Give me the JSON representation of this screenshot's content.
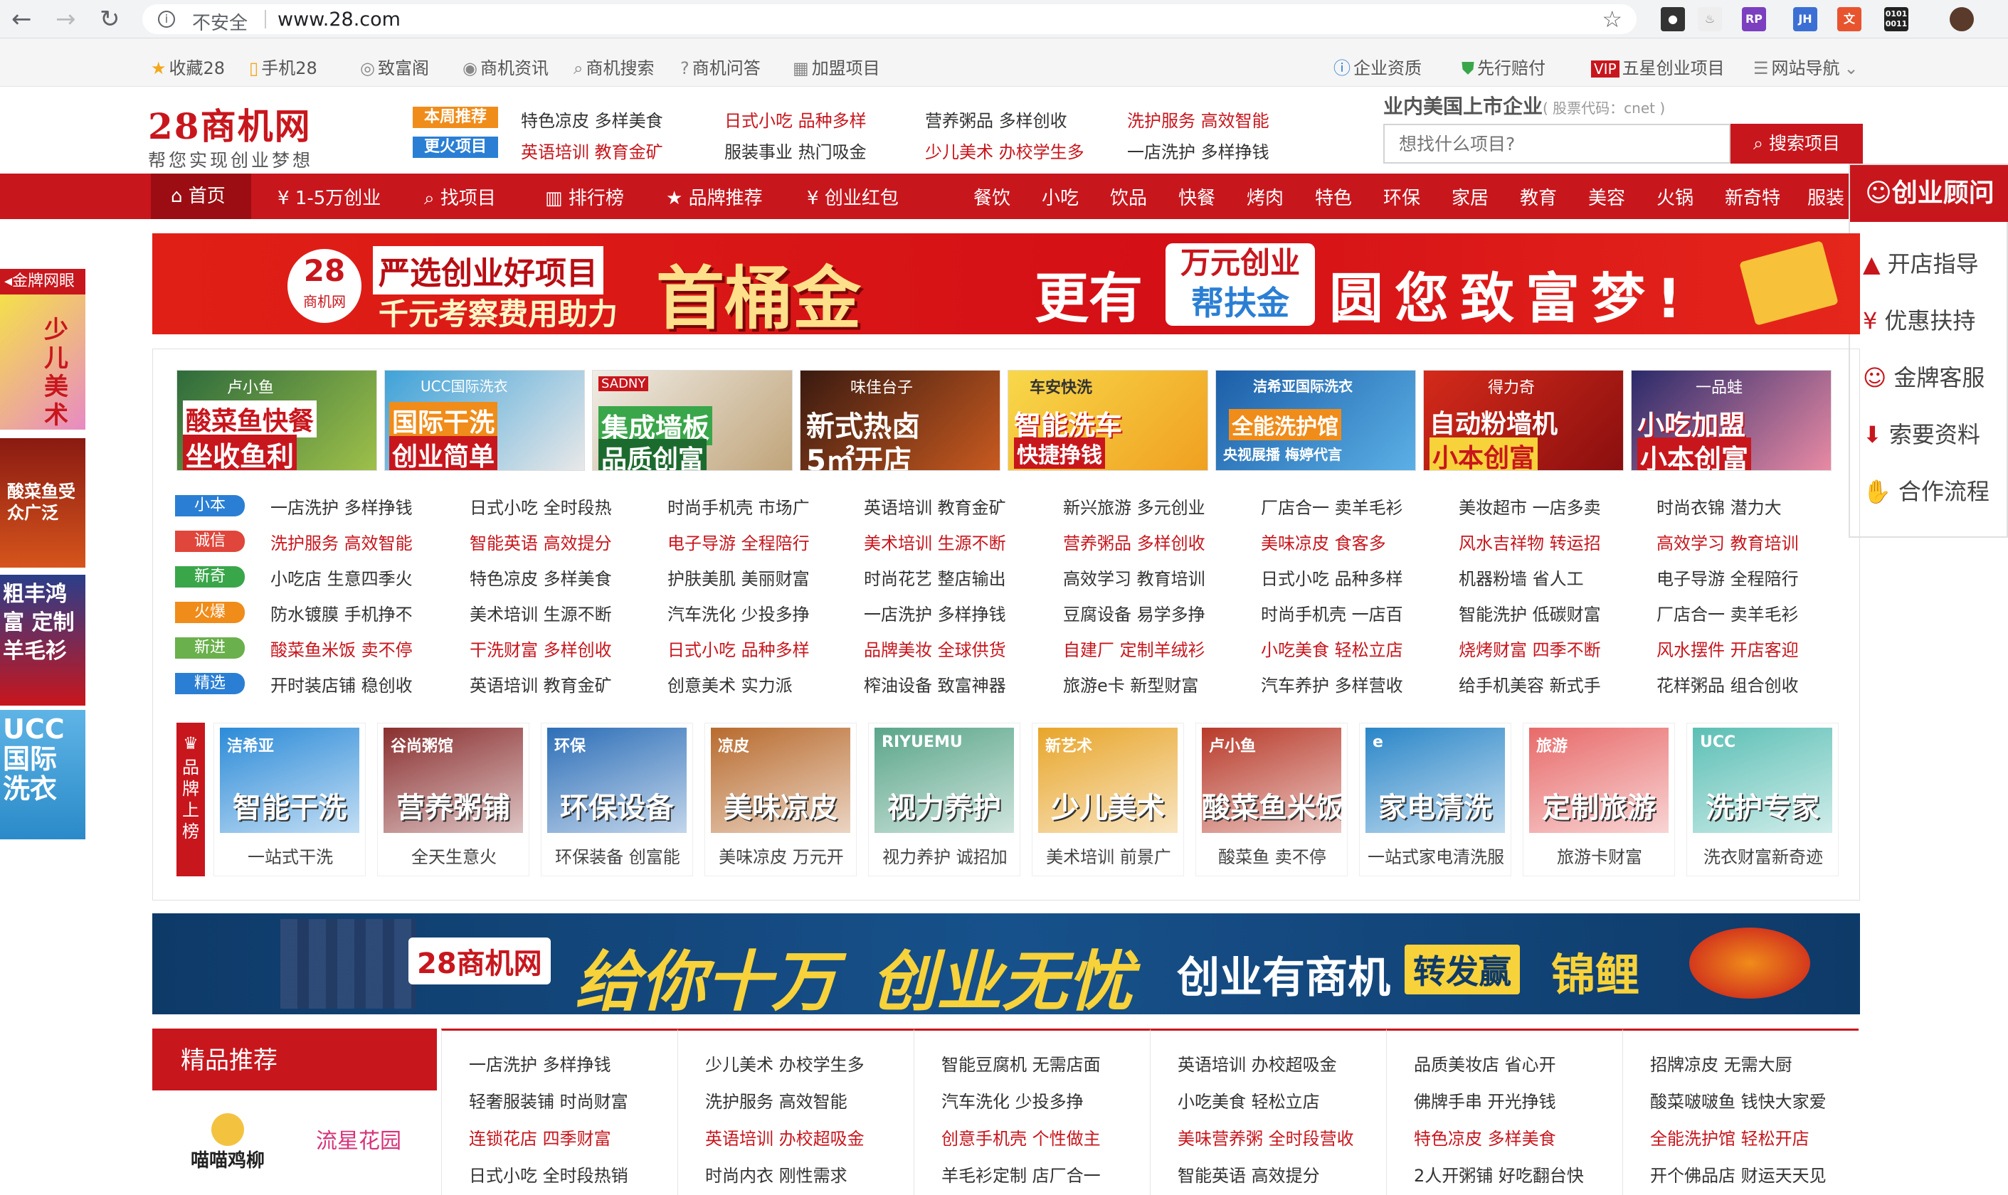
{
  "browser": {
    "security_label": "不安全",
    "url": "www.28.com"
  },
  "toplinks": {
    "left": [
      "收藏28",
      "手机28",
      "致富阁",
      "商机资讯",
      "商机搜索",
      "商机问答",
      "加盟项目"
    ],
    "right": [
      "企业资质",
      "先行赔付",
      "五星创业项目",
      "网站导航"
    ]
  },
  "header": {
    "logo_title": "28商机网",
    "logo_slogan": "帮您实现创业梦想",
    "badges": [
      "本周推荐",
      "更火项目"
    ],
    "links_row1": [
      "特色凉皮 多样美食",
      "日式小吃 品种多样",
      "营养粥品 多样创收",
      "洗护服务 高效智能"
    ],
    "links_row2": [
      "英语培训 教育金矿",
      "服装事业 热门吸金",
      "少儿美术 办校学生多",
      "一店洗护 多样挣钱"
    ],
    "listed_title": "业内美国上市企业",
    "listed_code": "( 股票代码：cnet )",
    "search_placeholder": "想找什么项目?",
    "search_button": "搜索项目"
  },
  "nav": {
    "main": [
      "首页",
      "1-5万创业",
      "找项目",
      "排行榜",
      "品牌推荐",
      "创业红包"
    ],
    "categories": [
      "餐饮",
      "小吃",
      "饮品",
      "快餐",
      "烤肉",
      "特色",
      "环保",
      "家居",
      "教育",
      "美容",
      "火锅",
      "新奇特",
      "服装"
    ]
  },
  "consult": {
    "title": "创业顾问",
    "items": [
      "开店指导",
      "优惠扶持",
      "金牌客服",
      "索要资料",
      "合作流程"
    ]
  },
  "banner1": {
    "logo": "28",
    "logo_sub": "商机网",
    "line1": "严选创业好项目",
    "line2": "千元考察费用助力",
    "big": "首桶金",
    "mid": "更有",
    "box1": "万元创业",
    "box2": "帮扶金",
    "tail": "圆您致富梦!"
  },
  "left_float": {
    "title": "金牌网眼",
    "ads": [
      "少儿美术",
      "酸菜鱼受众广泛",
      "粗丰鸿富 定制羊毛衫",
      "UCC国际洗衣"
    ]
  },
  "featured_tiles": [
    {
      "brand": "卢小鱼",
      "title": "酸菜鱼快餐",
      "sub": "坐收鱼利"
    },
    {
      "brand": "UCC国际洗衣",
      "title": "国际干洗",
      "sub": "创业简单"
    },
    {
      "brand": "SADNY",
      "title": "集成墙板",
      "sub": "品质创富"
    },
    {
      "brand": "味佳台子",
      "title": "新式热卤",
      "sub": "5㎡开店"
    },
    {
      "brand": "车安快洗",
      "title": "智能洗车",
      "sub": "快捷挣钱"
    },
    {
      "brand": "洁希亚国际洗衣",
      "title": "全能洗护馆",
      "sub": "央视展播 梅婷代言"
    },
    {
      "brand": "得力奇",
      "title": "自动粉墙机",
      "sub": "小本创富"
    },
    {
      "brand": "一品蛙",
      "title": "小吃加盟",
      "sub": "小本创富"
    }
  ],
  "tag_rows": [
    {
      "tag": "小本",
      "tag_color": "#2a7fd4",
      "items": [
        [
          "一店洗护 多样挣钱",
          0
        ],
        [
          "日式小吃 全时段热",
          0
        ],
        [
          "时尚手机壳 市场广",
          0
        ],
        [
          "英语培训 教育金矿",
          0
        ],
        [
          "新兴旅游 多元创业",
          0
        ],
        [
          "厂店合一 卖羊毛衫",
          0
        ],
        [
          "美妆超市 一店多卖",
          0
        ],
        [
          "时尚衣锦 潜力大",
          0
        ]
      ]
    },
    {
      "tag": "诚信",
      "tag_color": "#e0463b",
      "items": [
        [
          "洗护服务 高效智能",
          1
        ],
        [
          "智能英语 高效提分",
          1
        ],
        [
          "电子导游 全程陪行",
          1
        ],
        [
          "美术培训 生源不断",
          1
        ],
        [
          "营养粥品 多样创收",
          1
        ],
        [
          "美味凉皮 食客多",
          1
        ],
        [
          "风水吉祥物 转运招",
          1
        ],
        [
          "高效学习 教育培训",
          1
        ]
      ]
    },
    {
      "tag": "新奇",
      "tag_color": "#3aa64a",
      "items": [
        [
          "小吃店 生意四季火",
          0
        ],
        [
          "特色凉皮 多样美食",
          0
        ],
        [
          "护肤美肌 美丽财富",
          0
        ],
        [
          "时尚花艺 整店输出",
          0
        ],
        [
          "高效学习 教育培训",
          0
        ],
        [
          "日式小吃 品种多样",
          0
        ],
        [
          "机器粉墙 省人工",
          0
        ],
        [
          "电子导游 全程陪行",
          0
        ]
      ]
    },
    {
      "tag": "火爆",
      "tag_color": "#f08c1a",
      "items": [
        [
          "防水镀膜 手机挣不",
          0
        ],
        [
          "美术培训 生源不断",
          0
        ],
        [
          "汽车洗化 少投多挣",
          0
        ],
        [
          "一店洗护 多样挣钱",
          0
        ],
        [
          "豆腐设备 易学多挣",
          0
        ],
        [
          "时尚手机壳 一店百",
          0
        ],
        [
          "智能洗护 低碳财富",
          0
        ],
        [
          "厂店合一 卖羊毛衫",
          0
        ]
      ]
    },
    {
      "tag": "新进",
      "tag_color": "#6ab04c",
      "items": [
        [
          "酸菜鱼米饭 卖不停",
          1
        ],
        [
          "干洗财富 多样创收",
          1
        ],
        [
          "日式小吃 品种多样",
          1
        ],
        [
          "品牌美妆 全球供货",
          1
        ],
        [
          "自建厂 定制羊绒衫",
          1
        ],
        [
          "小吃美食 轻松立店",
          1
        ],
        [
          "烧烤财富 四季不断",
          1
        ],
        [
          "风水摆件 开店客迎",
          1
        ]
      ]
    },
    {
      "tag": "精选",
      "tag_color": "#2a7fd4",
      "items": [
        [
          "开时装店铺 稳创收",
          0
        ],
        [
          "英语培训 教育金矿",
          0
        ],
        [
          "创意美术 实力派",
          0
        ],
        [
          "榨油设备 致富神器",
          0
        ],
        [
          "旅游e卡 新型财富",
          0
        ],
        [
          "汽车养护 多样营收",
          0
        ],
        [
          "给手机美容 新式手",
          0
        ],
        [
          "花样粥品 组合创收",
          0
        ]
      ]
    }
  ],
  "brand_side": "品牌上榜",
  "brands": [
    {
      "title": "智能干洗",
      "logo": "洁希亚",
      "caption": "一站式干洗",
      "bg": "#2c8bd8"
    },
    {
      "title": "营养粥铺",
      "logo": "谷尚粥馆",
      "caption": "全天生意火",
      "bg": "#8a2f2f"
    },
    {
      "title": "环保设备",
      "logo": "环保",
      "caption": "环保装备 创富能",
      "bg": "#2d6fb8"
    },
    {
      "title": "美味凉皮",
      "logo": "凉皮",
      "caption": "美味凉皮 万元开",
      "bg": "#b86b2e"
    },
    {
      "title": "视力养护",
      "logo": "RIYUEMU",
      "caption": "视力养护 诚招加",
      "bg": "#5aa58a"
    },
    {
      "title": "少儿美术",
      "logo": "新艺术",
      "caption": "美术培训 前景广",
      "bg": "#e8a52a"
    },
    {
      "title": "酸菜鱼米饭",
      "logo": "卢小鱼",
      "caption": "酸菜鱼 卖不停",
      "bg": "#b83a2a"
    },
    {
      "title": "家电清洗",
      "logo": "e",
      "caption": "一站式家电清洗服",
      "bg": "#2a86c8"
    },
    {
      "title": "定制旅游",
      "logo": "旅游",
      "caption": "旅游卡财富",
      "bg": "#e86a6a"
    },
    {
      "title": "洗护专家",
      "logo": "UCC",
      "caption": "洗衣财富新奇迹",
      "bg": "#5bbfb5"
    }
  ],
  "banner2": {
    "logo": "28商机网",
    "big1": "给你十万",
    "big2": "创业无忧",
    "mid": "创业有商机",
    "box": "转发赢",
    "tail": "锦鲤"
  },
  "jingpin": {
    "title": "精品推荐",
    "logos": [
      "喵喵鸡柳",
      "流星花园"
    ]
  },
  "bottom_cols": [
    [
      [
        "一店洗护 多样挣钱",
        0
      ],
      [
        "轻奢服装铺 时尚财富",
        0
      ],
      [
        "连锁花店 四季财富",
        1
      ],
      [
        "日式小吃 全时段热销",
        0
      ]
    ],
    [
      [
        "少儿美术 办校学生多",
        0
      ],
      [
        "洗护服务 高效智能",
        0
      ],
      [
        "英语培训 办校超吸金",
        1
      ],
      [
        "时尚内衣 刚性需求",
        0
      ]
    ],
    [
      [
        "智能豆腐机 无需店面",
        0
      ],
      [
        "汽车洗化 少投多挣",
        0
      ],
      [
        "创意手机壳 个性做主",
        1
      ],
      [
        "羊毛衫定制 店厂合一",
        0
      ]
    ],
    [
      [
        "英语培训 办校超吸金",
        0
      ],
      [
        "小吃美食 轻松立店",
        0
      ],
      [
        "美味营养粥 全时段营收",
        1
      ],
      [
        "智能英语 高效提分",
        0
      ]
    ],
    [
      [
        "品质美妆店 省心开",
        0
      ],
      [
        "佛牌手串 开光挣钱",
        0
      ],
      [
        "特色凉皮 多样美食",
        1
      ],
      [
        "2人开粥铺 好吃翻台快",
        0
      ]
    ],
    [
      [
        "招牌凉皮 无需大厨",
        0
      ],
      [
        "酸菜啵啵鱼 钱快大家爱",
        0
      ],
      [
        "全能洗护馆 轻松开店",
        1
      ],
      [
        "开个佛品店 财运天天见",
        0
      ]
    ]
  ]
}
